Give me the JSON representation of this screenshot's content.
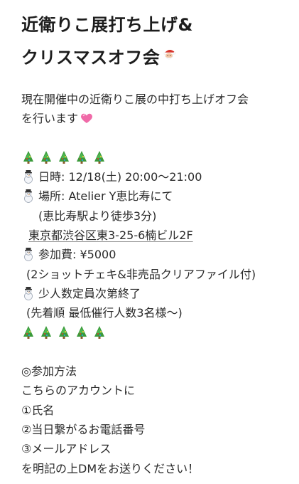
{
  "title": {
    "line1": "近衛りこ展打ち上げ&",
    "line2": "クリスマスオフ会"
  },
  "intro": {
    "line1": "現在開催中の近衛りこ展の中打ち上げオフ会",
    "line2": "を行います"
  },
  "details": {
    "datetime": "日時: 12/18(土) 20:00〜21:00",
    "venue": "場所: Atelier Y恵比寿にて",
    "access": "(恵比寿駅より徒歩3分)",
    "address": "東京都渋谷区東3-25-6楠ビル2F",
    "fee": "参加費: ¥5000",
    "fee_note": "(2ショットチェキ&非売品クリアファイル付)",
    "capacity": "少人数定員次第終了",
    "capacity_note": "(先着順 最低催行人数3名様〜)"
  },
  "how_to": {
    "heading": "◎参加方法",
    "line1": "こちらのアカウントに",
    "item1": "①氏名",
    "item2": "②当日繋がるお電話番号",
    "item3": "③メールアドレス",
    "closing": "を明記の上DMをお送りください！"
  },
  "icons": [
    "santa-emoji",
    "heart-emoji",
    "christmas-tree-emoji",
    "snowman-emoji"
  ],
  "colors": {
    "text": "#222222",
    "tree_green": "#3a9a3a",
    "heart_pink": "#f06aa8",
    "santa_red": "#d9342b"
  }
}
